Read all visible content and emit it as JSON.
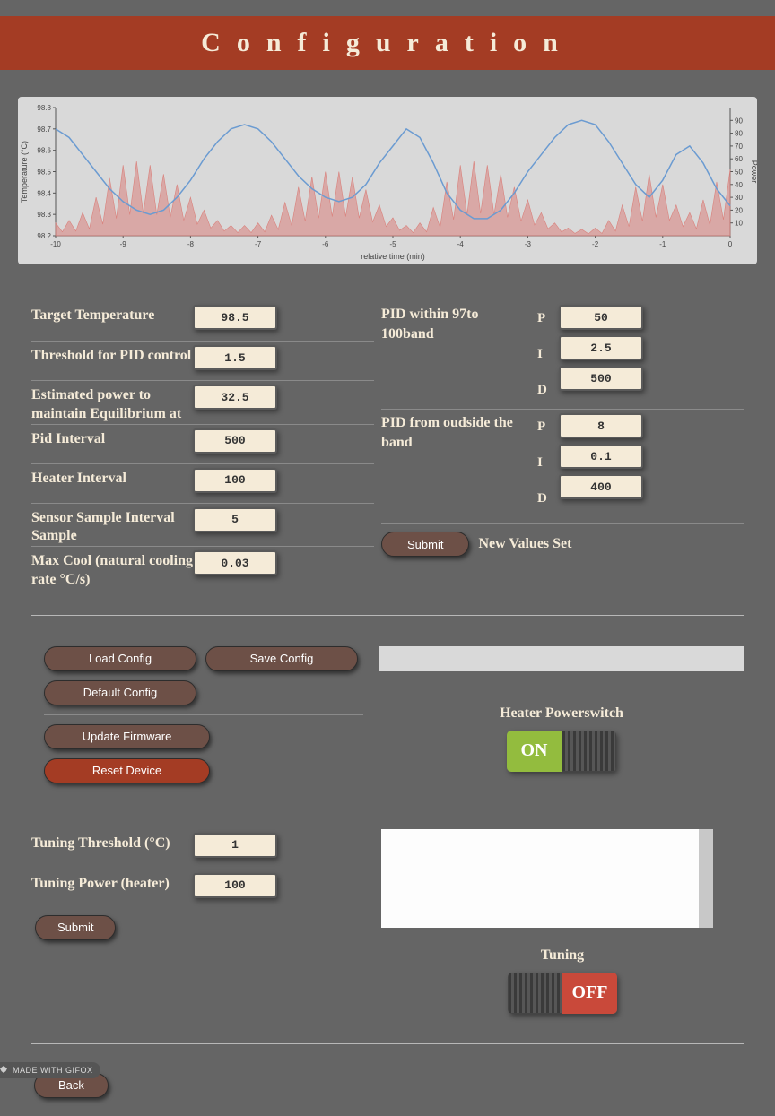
{
  "header": {
    "title": "Configuration"
  },
  "chart_data": {
    "type": "line",
    "title": "",
    "xlabel": "relative time (min)",
    "ylabel_left": "Temperature (°C)",
    "ylabel_right": "Power",
    "x_range": [
      -10,
      0
    ],
    "x_ticks": [
      -10,
      -9,
      -8,
      -7,
      -6,
      -5,
      -4,
      -3,
      -2,
      -1,
      0
    ],
    "y_left_range": [
      98.2,
      98.8
    ],
    "y_left_ticks": [
      98.2,
      98.3,
      98.4,
      98.5,
      98.6,
      98.7,
      98.8
    ],
    "y_right_range": [
      0,
      100
    ],
    "y_right_ticks": [
      10,
      20,
      30,
      40,
      50,
      60,
      70,
      80,
      90
    ],
    "series": [
      {
        "name": "Temperature",
        "axis": "left",
        "color": "#6b9bd1",
        "x": [
          -10,
          -9.8,
          -9.6,
          -9.4,
          -9.2,
          -9.0,
          -8.8,
          -8.6,
          -8.4,
          -8.2,
          -8.0,
          -7.8,
          -7.6,
          -7.4,
          -7.2,
          -7.0,
          -6.8,
          -6.6,
          -6.4,
          -6.2,
          -6.0,
          -5.8,
          -5.6,
          -5.4,
          -5.2,
          -5.0,
          -4.8,
          -4.6,
          -4.4,
          -4.2,
          -4.0,
          -3.8,
          -3.6,
          -3.4,
          -3.2,
          -3.0,
          -2.8,
          -2.6,
          -2.4,
          -2.2,
          -2.0,
          -1.8,
          -1.6,
          -1.4,
          -1.2,
          -1.0,
          -0.8,
          -0.6,
          -0.4,
          -0.2,
          0.0
        ],
        "values": [
          98.7,
          98.66,
          98.58,
          98.5,
          98.42,
          98.36,
          98.32,
          98.3,
          98.32,
          98.38,
          98.46,
          98.56,
          98.64,
          98.7,
          98.72,
          98.7,
          98.64,
          98.56,
          98.48,
          98.42,
          98.38,
          98.36,
          98.38,
          98.44,
          98.54,
          98.62,
          98.7,
          98.66,
          98.54,
          98.4,
          98.32,
          98.28,
          98.28,
          98.32,
          98.4,
          98.5,
          98.58,
          98.66,
          98.72,
          98.74,
          98.72,
          98.64,
          98.54,
          98.44,
          98.38,
          98.46,
          98.58,
          98.62,
          98.54,
          98.42,
          98.34
        ]
      },
      {
        "name": "Power",
        "axis": "right",
        "color": "#d9807b",
        "x": [
          -10,
          -9.8,
          -9.6,
          -9.4,
          -9.2,
          -9.0,
          -8.8,
          -8.6,
          -8.4,
          -8.2,
          -8.0,
          -7.8,
          -7.6,
          -7.4,
          -7.2,
          -7.0,
          -6.8,
          -6.6,
          -6.4,
          -6.2,
          -6.0,
          -5.8,
          -5.6,
          -5.4,
          -5.2,
          -5.0,
          -4.8,
          -4.6,
          -4.4,
          -4.2,
          -4.0,
          -3.8,
          -3.6,
          -3.4,
          -3.2,
          -3.0,
          -2.8,
          -2.6,
          -2.4,
          -2.2,
          -2.0,
          -1.8,
          -1.6,
          -1.4,
          -1.2,
          -1.0,
          -0.8,
          -0.6,
          -0.4,
          -0.2,
          0.0
        ],
        "values": [
          10,
          12,
          18,
          30,
          45,
          55,
          58,
          55,
          48,
          40,
          30,
          20,
          12,
          8,
          8,
          10,
          16,
          26,
          38,
          46,
          50,
          50,
          46,
          36,
          24,
          14,
          8,
          10,
          22,
          42,
          55,
          58,
          55,
          48,
          38,
          28,
          18,
          10,
          6,
          5,
          6,
          12,
          24,
          38,
          48,
          40,
          24,
          18,
          28,
          42,
          52
        ]
      }
    ]
  },
  "form_left": {
    "target_temp": {
      "label": "Target Temperature",
      "value": "98.5"
    },
    "threshold_pid": {
      "label": "Threshold for PID control",
      "value": "1.5"
    },
    "equilibrium_power": {
      "label": "Estimated power to maintain Equilibrium at",
      "value": "32.5"
    },
    "pid_interval": {
      "label": "Pid Interval",
      "value": "500"
    },
    "heater_interval": {
      "label": "Heater Interval",
      "value": "100"
    },
    "sensor_interval": {
      "label": "Sensor Sample Interval Sample",
      "value": "5"
    },
    "max_cool": {
      "label": "Max Cool (natural cooling rate °C/s)",
      "value": "0.03"
    }
  },
  "pid_within": {
    "label": "PID within 97to 100band",
    "p": "50",
    "i": "2.5",
    "d": "500"
  },
  "pid_outside": {
    "label": "PID from oudside the band",
    "p": "8",
    "i": "0.1",
    "d": "400"
  },
  "pid_letters": {
    "p": "P",
    "i": "I",
    "d": "D"
  },
  "buttons": {
    "submit": "Submit",
    "status": "New Values Set",
    "load_config": "Load Config",
    "save_config": "Save Config",
    "default_config": "Default Config",
    "update_firmware": "Update Firmware",
    "reset_device": "Reset Device",
    "back": "Back"
  },
  "heater_switch": {
    "label": "Heater Powerswitch",
    "state": "ON"
  },
  "tuning": {
    "threshold": {
      "label": "Tuning Threshold (°C)",
      "value": "1"
    },
    "power": {
      "label": "Tuning Power (heater)",
      "value": "100"
    },
    "switch_label": "Tuning",
    "switch_state": "OFF"
  },
  "gifox": "MADE WITH GIFOX"
}
